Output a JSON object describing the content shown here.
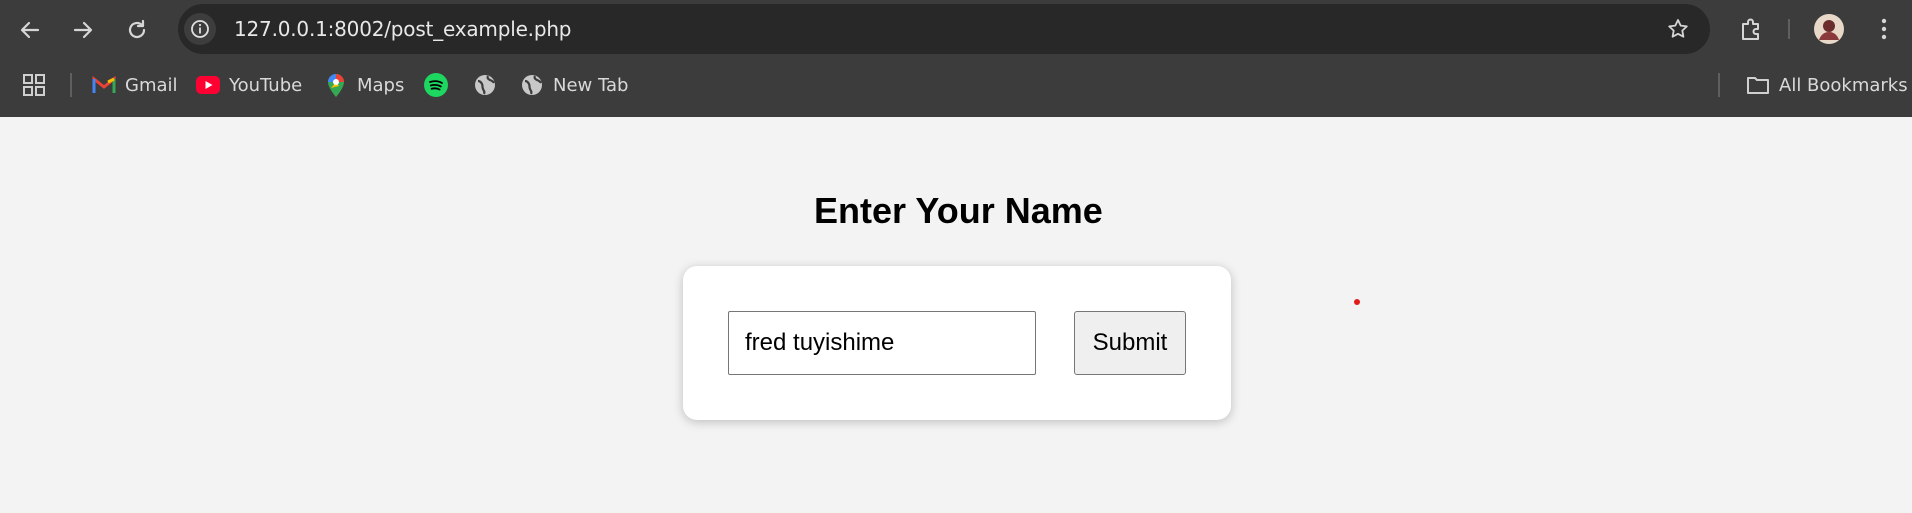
{
  "browser": {
    "url": "127.0.0.1:8002/post_example.php",
    "bookmarks": [
      {
        "label": "Gmail",
        "icon": "gmail-icon"
      },
      {
        "label": "YouTube",
        "icon": "youtube-icon"
      },
      {
        "label": "Maps",
        "icon": "maps-icon"
      },
      {
        "label": "",
        "icon": "spotify-icon"
      },
      {
        "label": "",
        "icon": "globe-icon"
      },
      {
        "label": "New Tab",
        "icon": "globe-icon"
      }
    ],
    "all_bookmarks_label": "All Bookmarks"
  },
  "page": {
    "title": "Enter Your Name",
    "name_input_value": "fred tuyishime",
    "submit_label": "Submit"
  },
  "colors": {
    "toolbar_bg": "#3c3c3c",
    "omnibox_bg": "#282828",
    "page_bg": "#f3f3f3",
    "card_bg": "#ffffff"
  }
}
